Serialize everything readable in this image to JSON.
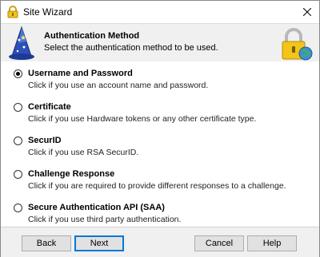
{
  "window": {
    "title": "Site Wizard"
  },
  "header": {
    "title": "Authentication Method",
    "subtitle": "Select the authentication method to be used."
  },
  "options": [
    {
      "label": "Username and Password",
      "description": "Click if you use an account name and password.",
      "selected": true
    },
    {
      "label": "Certificate",
      "description": "Click if you use Hardware tokens or any other certificate type.",
      "selected": false
    },
    {
      "label": "SecurID",
      "description": "Click if you use RSA SecurID.",
      "selected": false
    },
    {
      "label": "Challenge Response",
      "description": "Click if you are required to provide different responses to a challenge.",
      "selected": false
    },
    {
      "label": "Secure Authentication API (SAA)",
      "description": "Click if you use third party authentication.",
      "selected": false
    }
  ],
  "footer": {
    "back_label": "Back",
    "next_label": "Next",
    "cancel_label": "Cancel",
    "help_label": "Help"
  },
  "icons": {
    "title": "lock-icon",
    "close": "close-icon",
    "wizard": "wizard-hat-icon",
    "header_lock": "padlock-globe-icon"
  },
  "colors": {
    "accent": "#0078d7",
    "header_bg": "#f0f0f0",
    "footer_bg": "#f0f0f0"
  }
}
